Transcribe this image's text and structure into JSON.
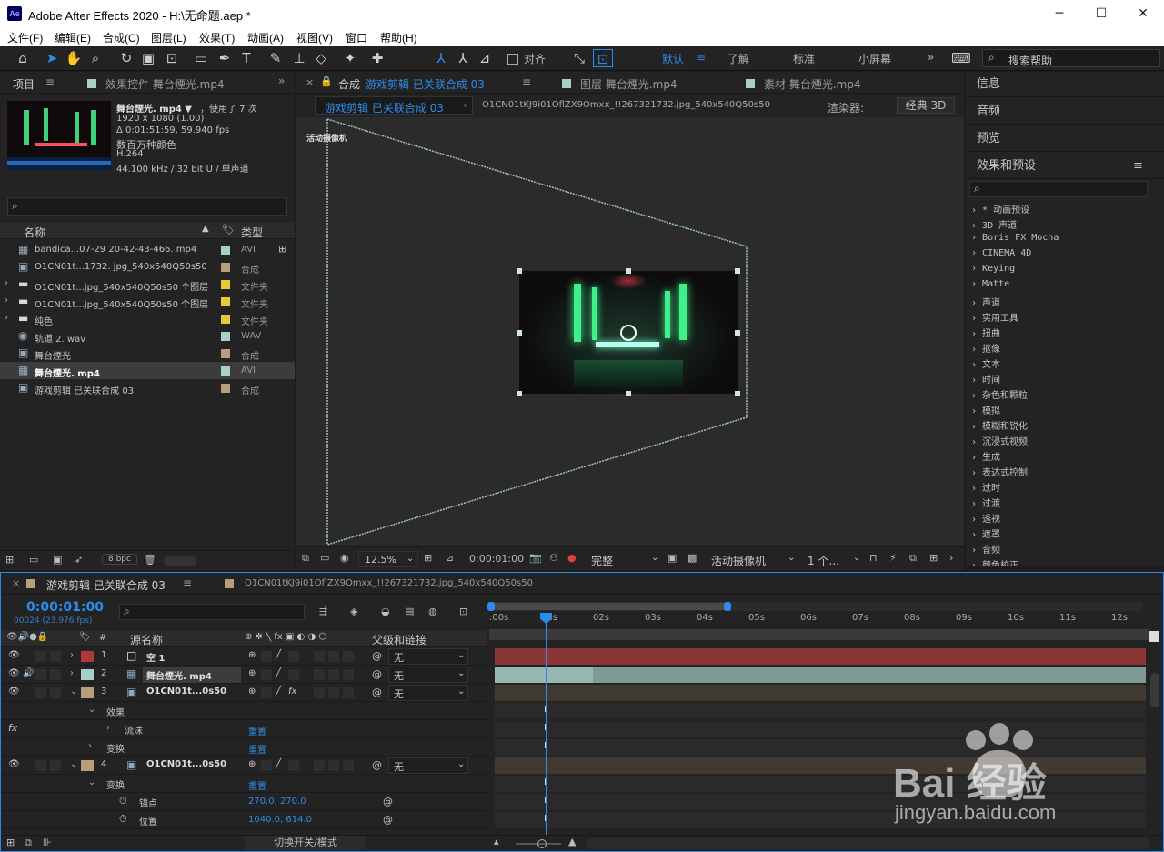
{
  "window": {
    "title": "Adobe After Effects 2020 - H:\\无命题.aep *",
    "logo": "Ae"
  },
  "menu": [
    "文件(F)",
    "编辑(E)",
    "合成(C)",
    "图层(L)",
    "效果(T)",
    "动画(A)",
    "视图(V)",
    "窗口",
    "帮助(H)"
  ],
  "toolbar": {
    "align_label": "对齐",
    "workspaces": [
      "默认",
      "了解",
      "标准",
      "小屏幕"
    ],
    "search_placeholder": "搜索帮助"
  },
  "project": {
    "tab_project": "项目",
    "tab_effect_controls": "效果控件 舞台煙光.mp4",
    "footage_name": "舞台煙光. mp4 ▼",
    "used_count": "，使用了 7 次",
    "resolution": "1920 x 1080 (1.00)",
    "duration": "Δ 0:01:51:59, 59.940 fps",
    "colors": "数百万种颜色",
    "codec": "H.264",
    "audio": "44.100 kHz / 32 bit U / 单声道",
    "col_name": "名称",
    "col_type": "类型",
    "items": [
      {
        "name": "bandica...07-29 20-42-43-466. mp4",
        "type": "AVI",
        "color": "#a9cfc9",
        "icon": "video-file-icon"
      },
      {
        "name": "O1CN01t...1732. jpg_540x540Q50s50",
        "type": "合成",
        "color": "#b89d7a",
        "icon": "comp-icon"
      },
      {
        "name": "O1CN01t...jpg_540x540Q50s50 个图层",
        "type": "文件夹",
        "color": "#e3c93c",
        "icon": "folder-icon"
      },
      {
        "name": "O1CN01t...jpg_540x540Q50s50 个图层",
        "type": "文件夹",
        "color": "#e3c93c",
        "icon": "folder-icon"
      },
      {
        "name": "纯色",
        "type": "文件夹",
        "color": "#e3c93c",
        "icon": "folder-icon"
      },
      {
        "name": "轨道 2. wav",
        "type": "WAV",
        "color": "#a9cfc9",
        "icon": "audio-file-icon"
      },
      {
        "name": "舞台煙光",
        "type": "合成",
        "color": "#b89d7a",
        "icon": "comp-icon"
      },
      {
        "name": "舞台煙光. mp4",
        "type": "AVI",
        "color": "#a9cfc9",
        "icon": "video-file-icon"
      },
      {
        "name": "游戏剪辑 已关联合成 03",
        "type": "合成",
        "color": "#b89d7a",
        "icon": "comp-icon"
      }
    ],
    "bpc": "8 bpc"
  },
  "composition": {
    "tab_comp_prefix": "合成",
    "tab_comp_name": "游戏剪辑 已关联合成 03",
    "tab_layer": "图层 舞台煙光.mp4",
    "tab_footage": "素材 舞台煙光.mp4",
    "breadcrumb_active": "游戏剪辑 已关联合成 03",
    "breadcrumb_next": "O1CN01tKJ9i01OflZX9Omxx_!!267321732.jpg_540x540Q50s50",
    "renderer_label": "渲染器:",
    "renderer_value": "经典 3D",
    "camera_label": "活动摄像机",
    "zoom": "12.5%",
    "timecode": "0:00:01:00",
    "quality": "完整",
    "view": "活动摄像机",
    "views_count": "1 个..."
  },
  "right_panels": {
    "info": "信息",
    "audio": "音频",
    "preview": "预览",
    "effects_presets": "效果和预设",
    "effects_list": [
      "* 动画预设",
      "3D 声道",
      "Boris FX Mocha",
      "CINEMA 4D",
      "Keying",
      "Matte",
      "声道",
      "实用工具",
      "扭曲",
      "抠像",
      "文本",
      "时间",
      "杂色和颗粒",
      "模拟",
      "模糊和锐化",
      "沉浸式视频",
      "生成",
      "表达式控制",
      "过时",
      "过渡",
      "透视",
      "遮罩",
      "音频",
      "颜色校正"
    ]
  },
  "timeline": {
    "tab_active": "游戏剪辑 已关联合成 03",
    "tab_other": "O1CN01tKJ9i01OflZX9Omxx_!!267321732.jpg_540x540Q50s50",
    "timecode": "0:00:01:00",
    "frame_info": "00024 (23.976 fps)",
    "col_source": "源名称",
    "col_parent": "父级和链接",
    "ruler": [
      ":00s",
      "01s",
      "02s",
      "03s",
      "04s",
      "05s",
      "06s",
      "07s",
      "08s",
      "09s",
      "10s",
      "11s",
      "12s"
    ],
    "layers": [
      {
        "num": "1",
        "name": "空 1",
        "parent": "无",
        "color": "#b3373a"
      },
      {
        "num": "2",
        "name": "舞台煙光. mp4",
        "parent": "无",
        "color": "#a9cfc9"
      },
      {
        "num": "3",
        "name": "O1CN01t...0s50",
        "parent": "无",
        "color": "#b89d7a"
      },
      {
        "num": "4",
        "name": "O1CN01t...0s50",
        "parent": "无",
        "color": "#b89d7a"
      }
    ],
    "prop_effects": "效果",
    "prop_flow": "流沫",
    "prop_transform": "变换",
    "reset": "重置",
    "prop_anchor": "锚点",
    "anchor_value": "270.0, 270.0",
    "prop_position": "位置",
    "position_value": "1040.0, 614.0",
    "toggle_switches": "切换开关/模式",
    "fx_label": "fx"
  },
  "watermark": {
    "brand": "Bai 经验",
    "url": "jingyan.baidu.com"
  },
  "colors": {
    "accent": "#2d8ceb",
    "panel_bg": "#232323",
    "null_bar": "#8a3536",
    "footage_bar": "#7e9a97"
  }
}
